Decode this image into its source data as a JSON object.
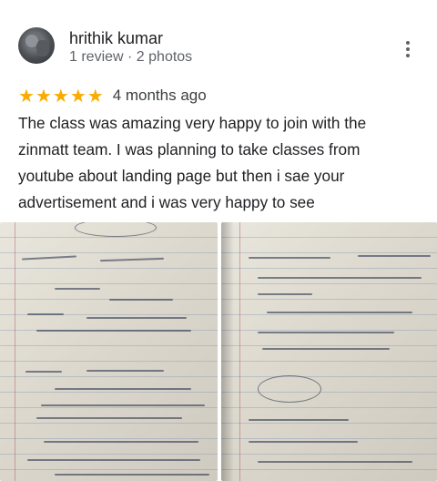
{
  "review": {
    "author": "hrithik kumar",
    "meta": "1 review · 2 photos",
    "rating": 5,
    "stars": [
      "★",
      "★",
      "★",
      "★",
      "★"
    ],
    "date": "4 months ago",
    "text": "The class was amazing very happy to join with the zinmatt team. I was planning to take classes from youtube about landing page but then i sae your advertisement and i was very happy to see"
  },
  "colors": {
    "star": "#f9ab00",
    "text": "#202124",
    "secondary": "#5f6368"
  },
  "icons": {
    "more": "more-vert-icon"
  },
  "photos": [
    {
      "label": "handwritten-notes-photo-1"
    },
    {
      "label": "handwritten-notes-photo-2"
    }
  ]
}
